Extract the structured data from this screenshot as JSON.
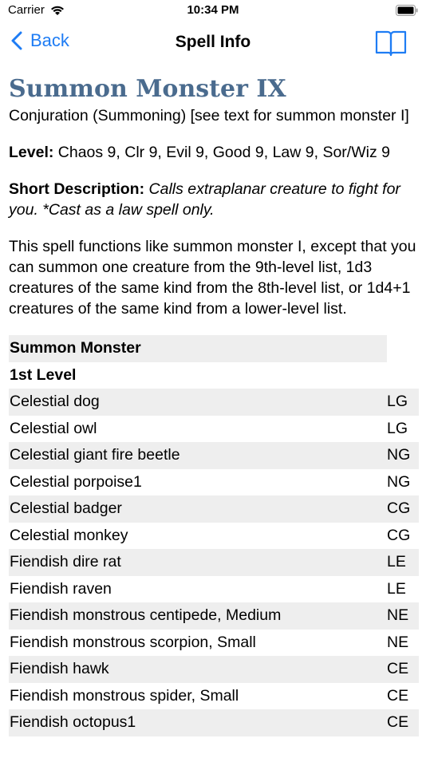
{
  "status_bar": {
    "carrier": "Carrier",
    "time": "10:34 PM"
  },
  "nav": {
    "back_label": "Back",
    "title": "Spell Info"
  },
  "spell": {
    "name": "Summon Monster IX",
    "school": "Conjuration (Summoning) [see text for summon monster I]",
    "level_label": "Level:",
    "level_value": " Chaos 9, Clr 9, Evil 9, Good 9, Law 9, Sor/Wiz 9",
    "short_desc_label": "Short Description:",
    "short_desc_value": " Calls extraplanar creature to fight for you. *Cast as a law spell only.",
    "body": "This spell functions like summon monster I, except that you can summon one creature from the 9th-level list, 1d3 creatures of the same kind from the 8th-level list, or 1d4+1 creatures of the same kind from a lower-level list."
  },
  "table": {
    "header": "Summon Monster",
    "subheader": "1st Level",
    "rows": [
      {
        "name": "Celestial dog",
        "alignment": "LG"
      },
      {
        "name": "Celestial owl",
        "alignment": "LG"
      },
      {
        "name": "Celestial giant fire beetle",
        "alignment": "NG"
      },
      {
        "name": "Celestial porpoise1",
        "alignment": "NG"
      },
      {
        "name": "Celestial badger",
        "alignment": "CG"
      },
      {
        "name": "Celestial monkey",
        "alignment": "CG"
      },
      {
        "name": "Fiendish dire rat",
        "alignment": "LE"
      },
      {
        "name": "Fiendish raven",
        "alignment": "LE"
      },
      {
        "name": "Fiendish monstrous centipede, Medium",
        "alignment": "NE"
      },
      {
        "name": "Fiendish monstrous scorpion, Small",
        "alignment": "NE"
      },
      {
        "name": "Fiendish hawk",
        "alignment": "CE"
      },
      {
        "name": "Fiendish monstrous spider, Small",
        "alignment": "CE"
      },
      {
        "name": "Fiendish octopus1",
        "alignment": "CE"
      }
    ]
  },
  "colors": {
    "accent": "#1e7cf4",
    "title": "#4a6b8e",
    "row_alt": "#eeeeee"
  }
}
